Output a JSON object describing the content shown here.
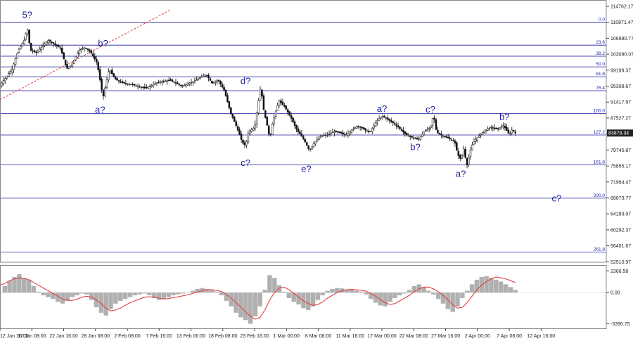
{
  "chart_data": {
    "type": "candlestick",
    "instrument_price_label": "83878.34",
    "main_panel": {
      "y_ticks": [
        "114762.17",
        "110871.47",
        "106980.77",
        "103090.07",
        "99199.37",
        "95308.67",
        "91417.97",
        "87527.27",
        "83636.57",
        "79745.87",
        "75855.17",
        "71964.47",
        "68073.77",
        "64183.07",
        "60292.37",
        "56401.67",
        "52510.97"
      ],
      "ylim": [
        52393.07,
        116300
      ],
      "current_price": 83878.34,
      "fib_levels": [
        {
          "label": "0.0",
          "value": 110871.47
        },
        {
          "label": "23.6",
          "value": 105300
        },
        {
          "label": "38.2",
          "value": 102600
        },
        {
          "label": "50.0",
          "value": 100000
        },
        {
          "label": "61.8",
          "value": 97600
        },
        {
          "label": "76.4",
          "value": 94200
        },
        {
          "label": "100.0",
          "value": 88600
        },
        {
          "label": "127.2",
          "value": 83400
        },
        {
          "label": "161.8",
          "value": 76100
        },
        {
          "label": "200.0",
          "value": 68000
        },
        {
          "label": "261.8",
          "value": 54900
        }
      ],
      "wave_labels": [
        {
          "text": "5?",
          "x": 0.045,
          "value": 111900
        },
        {
          "text": "b?",
          "x": 0.17,
          "value": 105000
        },
        {
          "text": "a?",
          "x": 0.165,
          "value": 88800
        },
        {
          "text": "d?",
          "x": 0.405,
          "value": 95800
        },
        {
          "text": "c?",
          "x": 0.405,
          "value": 75900
        },
        {
          "text": "e?",
          "x": 0.505,
          "value": 74400
        },
        {
          "text": "a?",
          "x": 0.63,
          "value": 89100
        },
        {
          "text": "c?",
          "x": 0.71,
          "value": 88900
        },
        {
          "text": "b?",
          "x": 0.685,
          "value": 79700
        },
        {
          "text": "a?",
          "x": 0.76,
          "value": 73200
        },
        {
          "text": "b?",
          "x": 0.832,
          "value": 87100
        },
        {
          "text": "c?",
          "x": 0.918,
          "value": 67200
        }
      ],
      "price_path": [
        [
          0.0,
          95500
        ],
        [
          0.01,
          97500
        ],
        [
          0.02,
          99500
        ],
        [
          0.03,
          104000
        ],
        [
          0.04,
          106500
        ],
        [
          0.045,
          109500
        ],
        [
          0.05,
          104000
        ],
        [
          0.06,
          103500
        ],
        [
          0.07,
          105000
        ],
        [
          0.08,
          106500
        ],
        [
          0.09,
          105500
        ],
        [
          0.1,
          104500
        ],
        [
          0.11,
          99500
        ],
        [
          0.12,
          101000
        ],
        [
          0.13,
          104000
        ],
        [
          0.14,
          104800
        ],
        [
          0.15,
          103500
        ],
        [
          0.16,
          101000
        ],
        [
          0.17,
          92500
        ],
        [
          0.175,
          96000
        ],
        [
          0.18,
          99500
        ],
        [
          0.19,
          97000
        ],
        [
          0.2,
          96200
        ],
        [
          0.22,
          95600
        ],
        [
          0.24,
          94800
        ],
        [
          0.26,
          96200
        ],
        [
          0.28,
          96800
        ],
        [
          0.3,
          95300
        ],
        [
          0.32,
          96500
        ],
        [
          0.34,
          98200
        ],
        [
          0.35,
          96000
        ],
        [
          0.36,
          96800
        ],
        [
          0.37,
          94200
        ],
        [
          0.38,
          89000
        ],
        [
          0.39,
          85500
        ],
        [
          0.4,
          81500
        ],
        [
          0.405,
          80800
        ],
        [
          0.41,
          84200
        ],
        [
          0.42,
          85300
        ],
        [
          0.43,
          95300
        ],
        [
          0.435,
          89500
        ],
        [
          0.44,
          86200
        ],
        [
          0.445,
          82500
        ],
        [
          0.45,
          86800
        ],
        [
          0.46,
          91800
        ],
        [
          0.47,
          90200
        ],
        [
          0.48,
          87600
        ],
        [
          0.49,
          84500
        ],
        [
          0.5,
          82600
        ],
        [
          0.505,
          81200
        ],
        [
          0.51,
          79700
        ],
        [
          0.52,
          81800
        ],
        [
          0.53,
          83200
        ],
        [
          0.54,
          83500
        ],
        [
          0.55,
          84200
        ],
        [
          0.56,
          84000
        ],
        [
          0.57,
          83300
        ],
        [
          0.58,
          84600
        ],
        [
          0.59,
          85700
        ],
        [
          0.6,
          84800
        ],
        [
          0.61,
          84000
        ],
        [
          0.62,
          86500
        ],
        [
          0.63,
          88100
        ],
        [
          0.64,
          87200
        ],
        [
          0.65,
          86200
        ],
        [
          0.66,
          84900
        ],
        [
          0.67,
          83400
        ],
        [
          0.68,
          82800
        ],
        [
          0.69,
          82300
        ],
        [
          0.7,
          84300
        ],
        [
          0.71,
          85200
        ],
        [
          0.715,
          88400
        ],
        [
          0.72,
          84100
        ],
        [
          0.73,
          83200
        ],
        [
          0.74,
          82600
        ],
        [
          0.75,
          81700
        ],
        [
          0.755,
          78600
        ],
        [
          0.76,
          77500
        ],
        [
          0.765,
          80200
        ],
        [
          0.77,
          75800
        ],
        [
          0.775,
          79200
        ],
        [
          0.78,
          81500
        ],
        [
          0.79,
          83200
        ],
        [
          0.8,
          84600
        ],
        [
          0.81,
          85300
        ],
        [
          0.82,
          84800
        ],
        [
          0.83,
          85700
        ],
        [
          0.835,
          84700
        ],
        [
          0.84,
          83500
        ],
        [
          0.845,
          84800
        ],
        [
          0.85,
          83900
        ]
      ]
    },
    "oscillator": {
      "y_ticks": [
        "2366.58",
        "0.00",
        "-3390.75"
      ],
      "ylim": [
        -3900,
        3000
      ],
      "histogram": [
        0,
        700,
        1300,
        1700,
        2000,
        1600,
        1400,
        700,
        100,
        -300,
        -500,
        -700,
        -1000,
        -1200,
        -900,
        -500,
        -300,
        -100,
        -200,
        -800,
        -1600,
        -2200,
        -2500,
        -1800,
        -1200,
        -900,
        -700,
        -500,
        -300,
        -200,
        -100,
        -300,
        -600,
        -800,
        -700,
        -500,
        -300,
        -200,
        -100,
        0,
        200,
        400,
        500,
        400,
        300,
        100,
        -300,
        -900,
        -1500,
        -2200,
        -2700,
        -3000,
        -3400,
        -2600,
        -1500,
        300,
        1900,
        1600,
        800,
        100,
        -600,
        -1000,
        -1300,
        -1700,
        -1900,
        -1500,
        -800,
        -300,
        200,
        400,
        500,
        450,
        350,
        300,
        200,
        100,
        -200,
        -700,
        -1100,
        -1400,
        -1500,
        -1000,
        -600,
        -300,
        -100,
        300,
        700,
        900,
        600,
        200,
        -200,
        -700,
        -1200,
        -1800,
        -2100,
        -1500,
        -600,
        200,
        900,
        1400,
        1700,
        1800,
        1600,
        1400,
        1200,
        900,
        600,
        300
      ],
      "signal": [
        800,
        1000,
        1300,
        1500,
        1600,
        1550,
        1400,
        1100,
        800,
        500,
        200,
        -100,
        -400,
        -700,
        -850,
        -850,
        -700,
        -500,
        -400,
        -500,
        -800,
        -1200,
        -1700,
        -2000,
        -1900,
        -1700,
        -1400,
        -1100,
        -900,
        -700,
        -500,
        -450,
        -500,
        -600,
        -700,
        -650,
        -550,
        -450,
        -350,
        -250,
        -100,
        50,
        200,
        300,
        300,
        250,
        100,
        -200,
        -600,
        -1100,
        -1600,
        -2100,
        -2600,
        -2900,
        -2700,
        -1900,
        -800,
        0,
        500,
        600,
        300,
        -100,
        -500,
        -900,
        -1200,
        -1400,
        -1300,
        -1000,
        -600,
        -300,
        0,
        200,
        300,
        350,
        300,
        250,
        150,
        -100,
        -400,
        -800,
        -1100,
        -1300,
        -1200,
        -900,
        -600,
        -300,
        100,
        400,
        600,
        600,
        400,
        100,
        -300,
        -800,
        -1300,
        -1700,
        -1600,
        -1100,
        -400,
        300,
        800,
        1200,
        1500,
        1700,
        1600,
        1500,
        1300,
        1100
      ]
    },
    "x_tick_labels": [
      "12 Jan 16:00",
      "17 Jan 08:00",
      "22 Jan 16:00",
      "28 Jan 08:00",
      "2 Feb 08:00",
      "7 Feb 16:00",
      "13 Feb 00:00",
      "18 Feb 08:00",
      "23 Feb 16:00",
      "1 Mar 00:00",
      "6 Mar 08:00",
      "11 Mar 16:00",
      "17 Mar 00:00",
      "22 Mar 08:00",
      "27 Mar 16:00",
      "2 Apr 00:00",
      "7 Apr 08:00",
      "12 Apr 16:00"
    ],
    "colors": {
      "fib_line": "#1a1aa0",
      "candle": "#111111",
      "signal_line": "#e04040",
      "histogram": "#b0b0b0",
      "trend_line": "#e03030"
    }
  }
}
